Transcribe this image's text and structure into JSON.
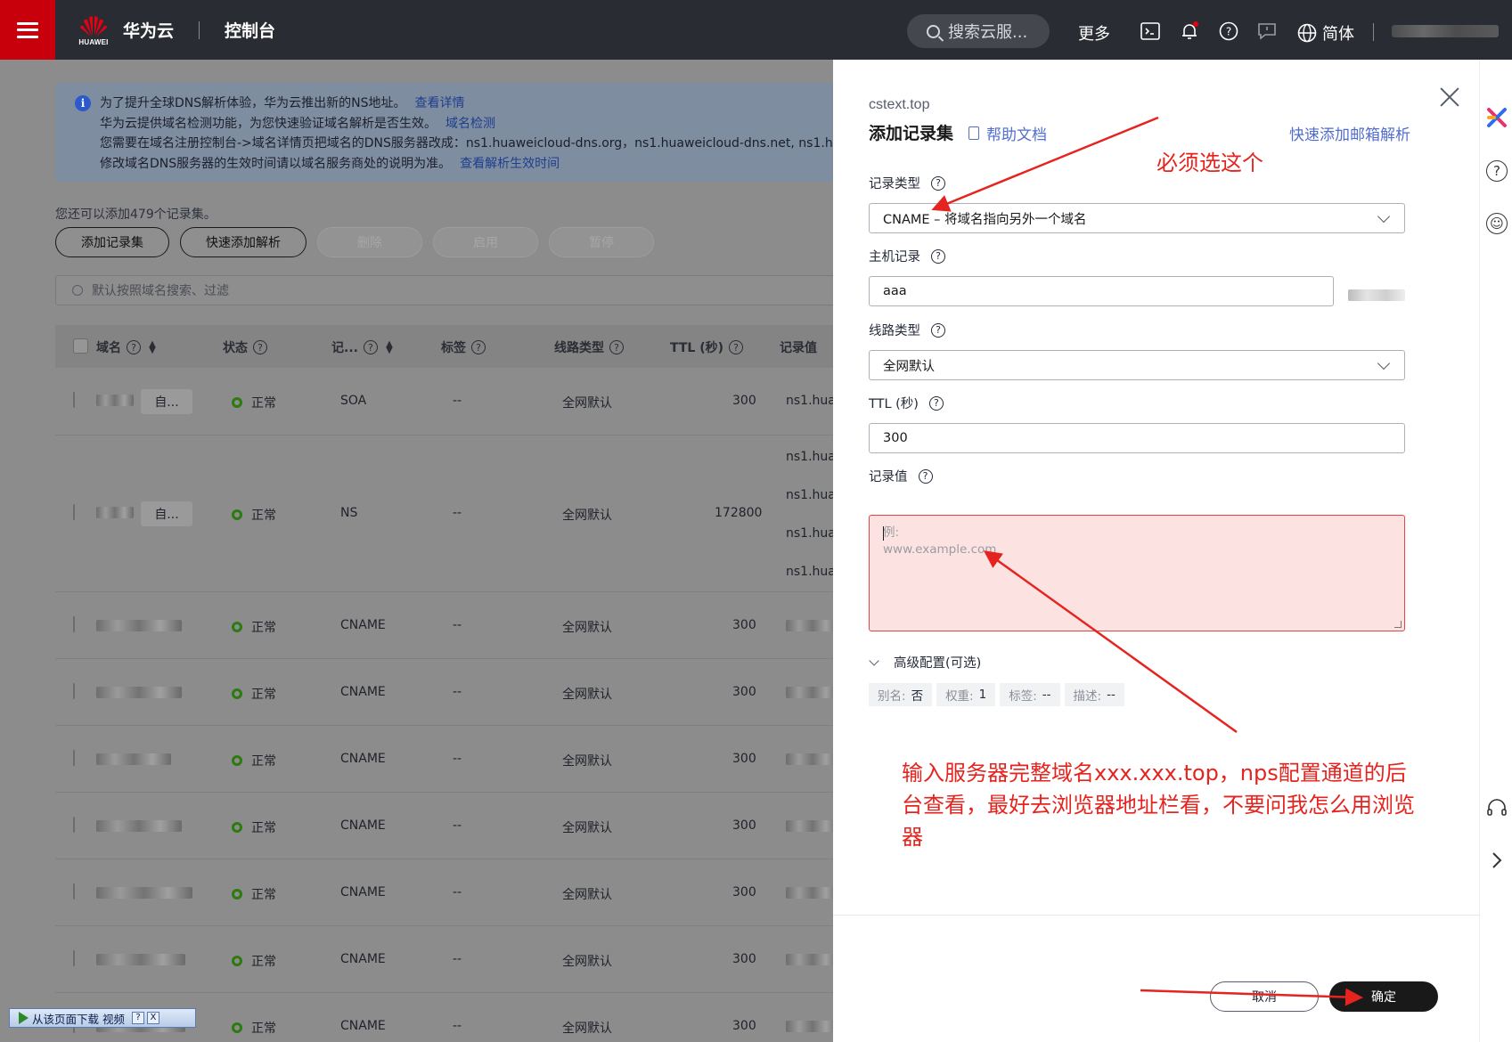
{
  "topbar": {
    "logo_text": "HUAWEI",
    "brand": "华为云",
    "console": "控制台",
    "search_placeholder": "搜索云服...",
    "more": "更多",
    "lang": "简体"
  },
  "notice": {
    "line1": "为了提升全球DNS解析体验，华为云推出新的NS地址。",
    "line1_link": "查看详情",
    "line2": "华为云提供域名检测功能，为您快速验证域名解析是否生效。",
    "line2_link": "域名检测",
    "line3": "您需要在域名注册控制台->域名详情页把域名的DNS服务器改成：ns1.huaweicloud-dns.org，ns1.huaweicloud-dns.net, ns1.h",
    "line4": "修改域名DNS服务器的生效时间请以域名服务商处的说明为准。",
    "line4_link": "查看解析生效时间"
  },
  "quota_text": "您还可以添加479个记录集。",
  "actions": {
    "add": "添加记录集",
    "quick_add": "快速添加解析",
    "delete": "删除",
    "enable": "启用",
    "pause": "暂停"
  },
  "list_search_placeholder": "默认按照域名搜索、过滤",
  "table": {
    "headers": {
      "domain": "域名",
      "status": "状态",
      "record_type": "记...",
      "tags": "标签",
      "line": "线路类型",
      "ttl": "TTL (秒)",
      "value": "记录值"
    },
    "rows": [
      {
        "tag_chip": "自...",
        "status": "正常",
        "type": "SOA",
        "tags": "--",
        "line": "全网默认",
        "ttl": "300",
        "values": [
          "ns1.hua"
        ]
      },
      {
        "tag_chip": "自...",
        "status": "正常",
        "type": "NS",
        "tags": "--",
        "line": "全网默认",
        "ttl": "172800",
        "values": [
          "ns1.hua",
          "ns1.hua",
          "ns1.hua",
          "ns1.hua"
        ]
      },
      {
        "status": "正常",
        "type": "CNAME",
        "tags": "--",
        "line": "全网默认",
        "ttl": "300"
      },
      {
        "status": "正常",
        "type": "CNAME",
        "tags": "--",
        "line": "全网默认",
        "ttl": "300"
      },
      {
        "status": "正常",
        "type": "CNAME",
        "tags": "--",
        "line": "全网默认",
        "ttl": "300"
      },
      {
        "status": "正常",
        "type": "CNAME",
        "tags": "--",
        "line": "全网默认",
        "ttl": "300"
      },
      {
        "status": "正常",
        "type": "CNAME",
        "tags": "--",
        "line": "全网默认",
        "ttl": "300"
      },
      {
        "status": "正常",
        "type": "CNAME",
        "tags": "--",
        "line": "全网默认",
        "ttl": "300"
      },
      {
        "status": "正常",
        "type": "CNAME",
        "tags": "--",
        "line": "全网默认",
        "ttl": "300"
      }
    ]
  },
  "drawer": {
    "domain": "cstext.top",
    "title": "添加记录集",
    "help_link": "帮助文档",
    "quick_mail": "快速添加邮箱解析",
    "record_type_label": "记录类型",
    "record_type_value": "CNAME – 将域名指向另外一个域名",
    "host_label": "主机记录",
    "host_value": "aaa",
    "line_label": "线路类型",
    "line_value": "全网默认",
    "ttl_label": "TTL (秒)",
    "ttl_value": "300",
    "value_label": "记录值",
    "value_placeholder_1": "例:",
    "value_placeholder_2": "www.example.com",
    "advanced": "高级配置(可选)",
    "chips": [
      {
        "k": "别名:",
        "v": "否"
      },
      {
        "k": "权重:",
        "v": "1"
      },
      {
        "k": "标签:",
        "v": "--"
      },
      {
        "k": "描述:",
        "v": "--"
      }
    ],
    "cancel": "取消",
    "confirm": "确定"
  },
  "annotations": {
    "top": "必须选这个",
    "bottom": "输入服务器完整域名xxx.xxx.top，nps配置通道的后台查看，最好去浏览器地址栏看，不要问我怎么用浏览器"
  },
  "download_bar": {
    "label": "从该页面下载 视频",
    "help": "?",
    "close": "X"
  },
  "colors": {
    "brand_red": "#c7000b",
    "link_blue": "#526ecc",
    "annotation_red": "#e5241f",
    "status_green": "#2e7a12"
  }
}
